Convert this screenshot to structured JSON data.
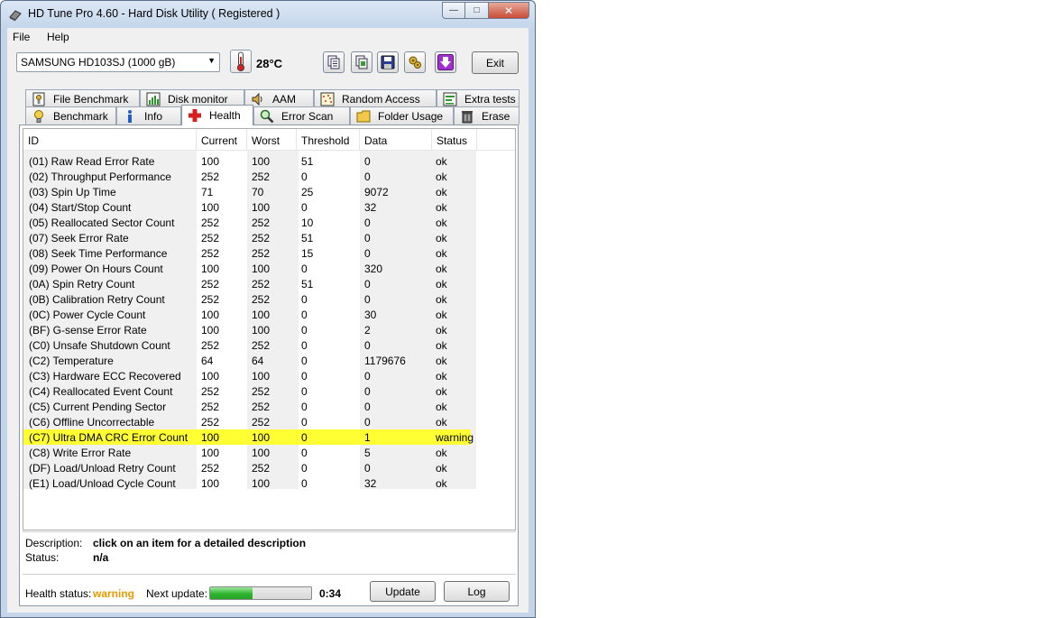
{
  "window": {
    "title": "HD Tune Pro 4.60 - Hard Disk Utility ( Registered )",
    "controls": {
      "minimize": "—",
      "maximize": "□",
      "close": "✕"
    }
  },
  "menu": {
    "file": "File",
    "help": "Help"
  },
  "toolbar": {
    "drive": "SAMSUNG HD103SJ (1000 gB)",
    "temperature": "28°C",
    "exit_label": "Exit",
    "icons": [
      "copy-text-icon",
      "copy-screenshot-icon",
      "save-icon",
      "options-icon",
      "download-icon"
    ]
  },
  "tabs_top": [
    {
      "label": "File Benchmark",
      "icon": "file-benchmark-icon"
    },
    {
      "label": "Disk monitor",
      "icon": "disk-monitor-icon"
    },
    {
      "label": "AAM",
      "icon": "speaker-icon"
    },
    {
      "label": "Random Access",
      "icon": "random-access-icon"
    },
    {
      "label": "Extra tests",
      "icon": "extra-tests-icon"
    }
  ],
  "tabs_bottom": [
    {
      "label": "Benchmark",
      "icon": "benchmark-icon"
    },
    {
      "label": "Info",
      "icon": "info-icon"
    },
    {
      "label": "Health",
      "icon": "health-cross-icon"
    },
    {
      "label": "Error Scan",
      "icon": "magnifier-icon"
    },
    {
      "label": "Folder Usage",
      "icon": "folder-icon"
    },
    {
      "label": "Erase",
      "icon": "trash-icon"
    }
  ],
  "active_tab": "Health",
  "table": {
    "headers": [
      "ID",
      "Current",
      "Worst",
      "Threshold",
      "Data",
      "Status"
    ],
    "rows": [
      [
        "(01) Raw Read Error Rate",
        "100",
        "100",
        "51",
        "0",
        "ok"
      ],
      [
        "(02) Throughput Performance",
        "252",
        "252",
        "0",
        "0",
        "ok"
      ],
      [
        "(03) Spin Up Time",
        "71",
        "70",
        "25",
        "9072",
        "ok"
      ],
      [
        "(04) Start/Stop Count",
        "100",
        "100",
        "0",
        "32",
        "ok"
      ],
      [
        "(05) Reallocated Sector Count",
        "252",
        "252",
        "10",
        "0",
        "ok"
      ],
      [
        "(07) Seek Error Rate",
        "252",
        "252",
        "51",
        "0",
        "ok"
      ],
      [
        "(08) Seek Time Performance",
        "252",
        "252",
        "15",
        "0",
        "ok"
      ],
      [
        "(09) Power On Hours Count",
        "100",
        "100",
        "0",
        "320",
        "ok"
      ],
      [
        "(0A) Spin Retry Count",
        "252",
        "252",
        "51",
        "0",
        "ok"
      ],
      [
        "(0B) Calibration Retry Count",
        "252",
        "252",
        "0",
        "0",
        "ok"
      ],
      [
        "(0C) Power Cycle Count",
        "100",
        "100",
        "0",
        "30",
        "ok"
      ],
      [
        "(BF) G-sense Error Rate",
        "100",
        "100",
        "0",
        "2",
        "ok"
      ],
      [
        "(C0) Unsafe Shutdown Count",
        "252",
        "252",
        "0",
        "0",
        "ok"
      ],
      [
        "(C2) Temperature",
        "64",
        "64",
        "0",
        "1179676",
        "ok"
      ],
      [
        "(C3) Hardware ECC Recovered",
        "100",
        "100",
        "0",
        "0",
        "ok"
      ],
      [
        "(C4) Reallocated Event Count",
        "252",
        "252",
        "0",
        "0",
        "ok"
      ],
      [
        "(C5) Current Pending Sector",
        "252",
        "252",
        "0",
        "0",
        "ok"
      ],
      [
        "(C6) Offline Uncorrectable",
        "252",
        "252",
        "0",
        "0",
        "ok"
      ],
      [
        "(C7) Ultra DMA CRC Error Count",
        "100",
        "100",
        "0",
        "1",
        "warning"
      ],
      [
        "(C8) Write Error Rate",
        "100",
        "100",
        "0",
        "5",
        "ok"
      ],
      [
        "(DF) Load/Unload Retry Count",
        "252",
        "252",
        "0",
        "0",
        "ok"
      ],
      [
        "(E1) Load/Unload Cycle Count",
        "100",
        "100",
        "0",
        "32",
        "ok"
      ]
    ],
    "highlight_color": "#ffff33"
  },
  "details": {
    "description_label": "Description:",
    "description_value": "click on an item for a detailed description",
    "status_label": "Status:",
    "status_value": "n/a"
  },
  "footer": {
    "health_label": "Health status:",
    "health_value": "warning",
    "health_color": "#e69a00",
    "next_update_label": "Next update:",
    "progress_fraction": 0.42,
    "countdown": "0:34",
    "update_label": "Update",
    "log_label": "Log"
  }
}
